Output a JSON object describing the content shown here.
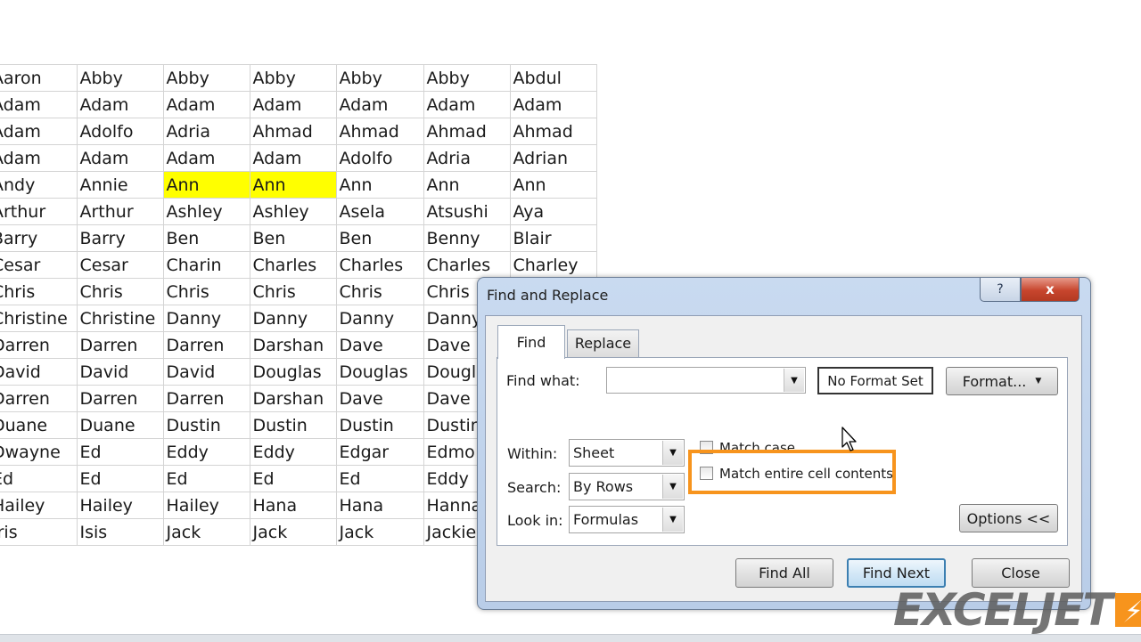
{
  "sheet": {
    "rows": [
      [
        "Aaron",
        "Abby",
        "Abby",
        "Abby",
        "Abby",
        "Abby",
        "Abdul"
      ],
      [
        "Adam",
        "Adam",
        "Adam",
        "Adam",
        "Adam",
        "Adam",
        "Adam"
      ],
      [
        "Adam",
        "Adolfo",
        "Adria",
        "Ahmad",
        "Ahmad",
        "Ahmad",
        "Ahmad"
      ],
      [
        "Adam",
        "Adam",
        "Adam",
        "Adam",
        "Adolfo",
        "Adria",
        "Adrian"
      ],
      [
        "Andy",
        "Annie",
        "Ann",
        "Ann",
        "Ann",
        "Ann",
        "Ann"
      ],
      [
        "Arthur",
        "Arthur",
        "Ashley",
        "Ashley",
        "Asela",
        "Atsushi",
        "Aya"
      ],
      [
        "Barry",
        "Barry",
        "Ben",
        "Ben",
        "Ben",
        "Benny",
        "Blair"
      ],
      [
        "Cesar",
        "Cesar",
        "Charin",
        "Charles",
        "Charles",
        "Charles",
        "Charley"
      ],
      [
        "Chris",
        "Chris",
        "Chris",
        "Chris",
        "Chris",
        "Chris",
        ""
      ],
      [
        "Christine",
        "Christine",
        "Danny",
        "Danny",
        "Danny",
        "Danny",
        ""
      ],
      [
        "Darren",
        "Darren",
        "Darren",
        "Darshan",
        "Dave",
        "Dave",
        ""
      ],
      [
        "David",
        "David",
        "David",
        "Douglas",
        "Douglas",
        "Dougl",
        ""
      ],
      [
        "Darren",
        "Darren",
        "Darren",
        "Darshan",
        "Dave",
        "Dave",
        ""
      ],
      [
        "Duane",
        "Duane",
        "Dustin",
        "Dustin",
        "Dustin",
        "Dustin",
        ""
      ],
      [
        "Dwayne",
        "Ed",
        "Eddy",
        "Eddy",
        "Edgar",
        "Edmo",
        ""
      ],
      [
        "Ed",
        "Ed",
        "Ed",
        "Ed",
        "Ed",
        "Eddy",
        ""
      ],
      [
        "Hailey",
        "Hailey",
        "Hailey",
        "Hana",
        "Hana",
        "Hanna",
        ""
      ],
      [
        "Iris",
        "Isis",
        "Jack",
        "Jack",
        "Jack",
        "Jackie",
        ""
      ]
    ],
    "highlight_color": "#ffff00"
  },
  "dialog": {
    "title": "Find and Replace",
    "help_label": "?",
    "close_label": "x",
    "tabs": {
      "find": "Find",
      "replace": "Replace"
    },
    "find_what_label": "Find what:",
    "find_what_value": "",
    "no_format_label": "No Format Set",
    "format_button": "Format...",
    "within_label": "Within:",
    "within_value": "Sheet",
    "search_label": "Search:",
    "search_value": "By Rows",
    "lookin_label": "Look in:",
    "lookin_value": "Formulas",
    "match_case_label": "Match case",
    "match_case_checked": false,
    "match_entire_label": "Match entire cell contents",
    "match_entire_checked": false,
    "options_button": "Options <<",
    "find_all_button": "Find All",
    "find_next_button": "Find Next",
    "close_button": "Close"
  },
  "accent_color": "#f7941d",
  "logo_text": "EXCELJET"
}
